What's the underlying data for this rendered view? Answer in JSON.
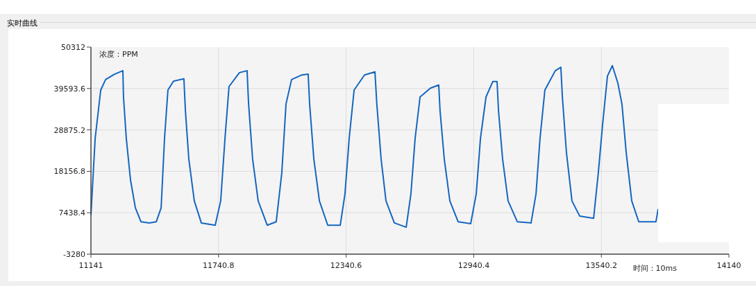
{
  "group_title": "实时曲线",
  "chart_data": {
    "type": "line",
    "xlabel": "时间：10ms",
    "ylabel": "浓度：PPM",
    "xlim": [
      11141,
      14140
    ],
    "ylim": [
      -3280,
      50312
    ],
    "xticks": [
      {
        "value": 11141,
        "label": "11141"
      },
      {
        "value": 11740.8,
        "label": "11740.8"
      },
      {
        "value": 12340.6,
        "label": "12340.6"
      },
      {
        "value": 12940.4,
        "label": "12940.4"
      },
      {
        "value": 13540.2,
        "label": "13540.2"
      },
      {
        "value": 14140,
        "label": "14140"
      }
    ],
    "yticks": [
      {
        "value": -3280,
        "label": "-3280"
      },
      {
        "value": 7438.4,
        "label": "7438.4"
      },
      {
        "value": 18156.8,
        "label": "18156.8"
      },
      {
        "value": 28875.2,
        "label": "28875.2"
      },
      {
        "value": 39593.6,
        "label": "39593.6"
      },
      {
        "value": 50312,
        "label": "50312"
      }
    ],
    "x": [
      11141,
      11161,
      11187,
      11210,
      11252,
      11291,
      11294,
      11307,
      11327,
      11350,
      11376,
      11415,
      11448,
      11471,
      11487,
      11503,
      11529,
      11578,
      11585,
      11601,
      11627,
      11660,
      11725,
      11751,
      11771,
      11790,
      11839,
      11875,
      11882,
      11901,
      11927,
      11970,
      12012,
      12038,
      12058,
      12084,
      12133,
      12162,
      12169,
      12189,
      12215,
      12254,
      12313,
      12335,
      12355,
      12378,
      12427,
      12476,
      12485,
      12505,
      12528,
      12567,
      12623,
      12645,
      12665,
      12688,
      12737,
      12776,
      12782,
      12802,
      12828,
      12867,
      12926,
      12952,
      12972,
      12998,
      13030,
      13050,
      13057,
      13076,
      13102,
      13145,
      13210,
      13233,
      13252,
      13275,
      13324,
      13350,
      13357,
      13376,
      13402,
      13438,
      13504,
      13526,
      13546,
      13569,
      13592,
      13618,
      13637,
      13657,
      13683,
      13716,
      13797,
      13807
    ],
    "grid": true,
    "series": [
      {
        "color": "#1565c0",
        "values": [
          6900,
          26700,
          39200,
          41900,
          43300,
          44200,
          37400,
          26700,
          15900,
          8700,
          5100,
          4800,
          5100,
          8700,
          26700,
          39200,
          41500,
          42100,
          33800,
          21300,
          10500,
          4800,
          4200,
          10500,
          26700,
          40100,
          43700,
          44200,
          35600,
          21300,
          10500,
          4200,
          5100,
          17700,
          35600,
          41900,
          43100,
          43300,
          35600,
          21300,
          10500,
          4200,
          4200,
          12300,
          26700,
          39200,
          43100,
          43900,
          35600,
          21300,
          10500,
          4800,
          3700,
          12300,
          26700,
          37400,
          39700,
          40500,
          33800,
          21300,
          10500,
          5100,
          4600,
          12300,
          26700,
          37400,
          41400,
          41400,
          33800,
          21300,
          10500,
          5100,
          4800,
          12300,
          26700,
          39200,
          44200,
          45100,
          37400,
          23100,
          10500,
          6600,
          6000,
          17700,
          30200,
          42800,
          45500,
          41000,
          35600,
          23100,
          10500,
          5100,
          5100,
          8400
        ]
      }
    ]
  }
}
